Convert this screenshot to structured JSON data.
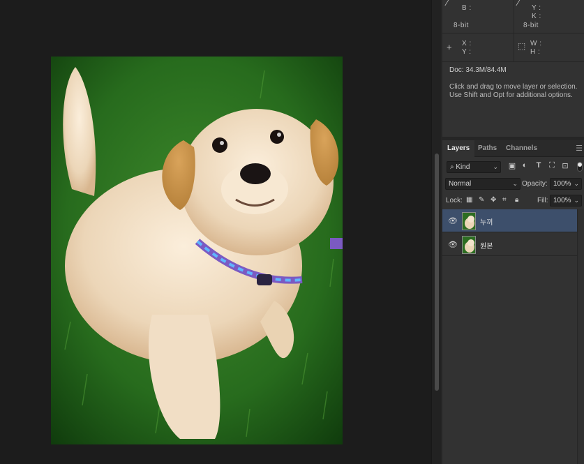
{
  "info": {
    "left_top": {
      "line1": "B :",
      "line2": "8-bit"
    },
    "right_top": {
      "line1": "Y :",
      "line2": "K :",
      "line3": "8-bit"
    },
    "left_mid": {
      "x": "X :",
      "y": "Y :"
    },
    "right_mid": {
      "w": "W :",
      "h": "H :"
    },
    "doc_size": "Doc: 34.3M/84.4M",
    "help_text": "Click and drag to move layer or selection.  Use Shift and Opt for additional options."
  },
  "layers_panel": {
    "tabs": [
      {
        "label": "Layers",
        "active": true
      },
      {
        "label": "Paths",
        "active": false
      },
      {
        "label": "Channels",
        "active": false
      }
    ],
    "filter": {
      "value": "Kind"
    },
    "blend_mode": "Normal",
    "opacity_label": "Opacity:",
    "opacity_value": "100%",
    "lock_label": "Lock:",
    "fill_label": "Fill:",
    "fill_value": "100%",
    "layers": [
      {
        "name": "누끼",
        "selected": true,
        "visible": true
      },
      {
        "name": "원본",
        "selected": false,
        "visible": true
      }
    ]
  },
  "colors": {
    "selection": "#3d4f6b",
    "panel_bg": "#323232",
    "canvas_bg": "#1c1c1c"
  },
  "icons": {
    "eyedropper": "eyedropper-icon",
    "crosshair": "crosshair-icon",
    "selection": "selection-rect-icon",
    "eye": "eye-icon",
    "menu": "panel-menu-icon"
  }
}
